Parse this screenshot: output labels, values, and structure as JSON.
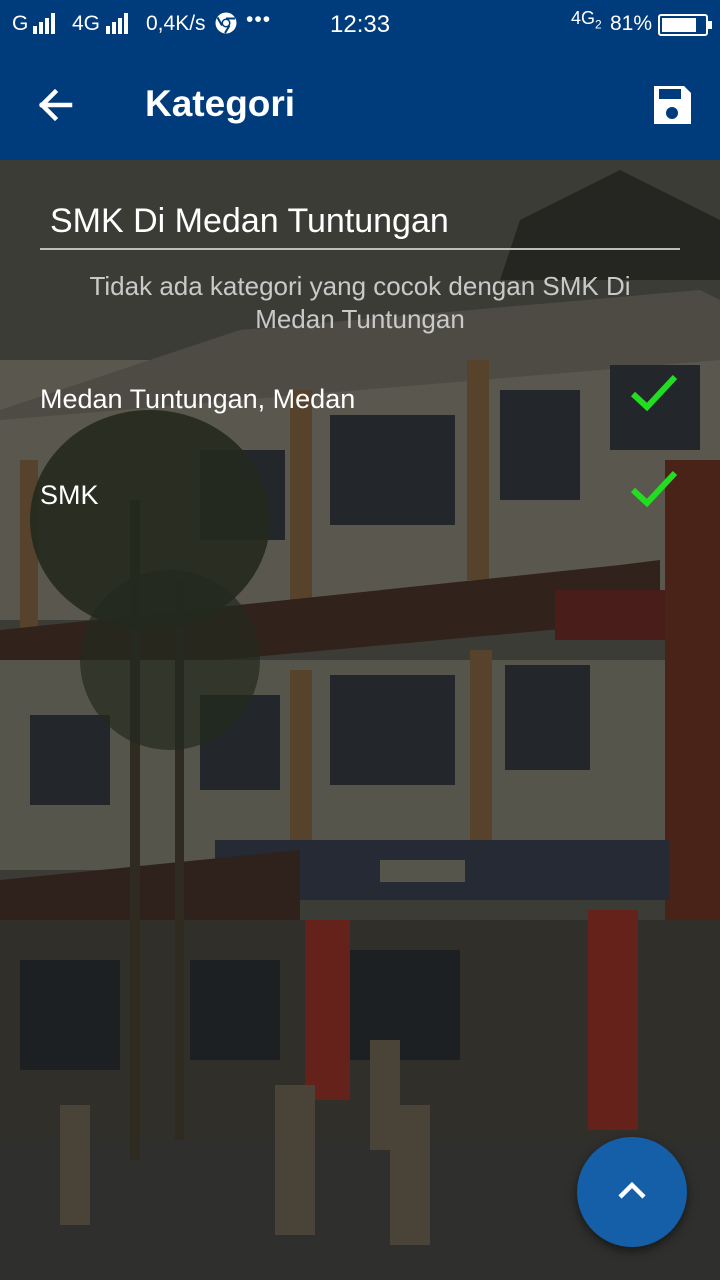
{
  "status_bar": {
    "network_1": "G",
    "network_2": "4G",
    "speed": "0,4K/s",
    "more": "•••",
    "time": "12:33",
    "network_3": "4G",
    "network_3_sub": "2",
    "battery": "81%"
  },
  "app_bar": {
    "title": "Kategori",
    "back_icon": "arrow-left-icon",
    "save_icon": "floppy-disk-icon"
  },
  "search": {
    "value": "SMK Di Medan Tuntungan",
    "placeholder": ""
  },
  "no_match_message": "Tidak ada kategori yang cocok dengan  SMK Di\nMedan Tuntungan",
  "categories": [
    {
      "label": "Medan Tuntungan, Medan",
      "checked": true
    },
    {
      "label": "SMK",
      "checked": true
    }
  ],
  "fab": {
    "icon": "chevron-up-icon"
  },
  "colors": {
    "primary": "#003b7c",
    "fab": "#145fa8",
    "check": "#22dd22"
  }
}
